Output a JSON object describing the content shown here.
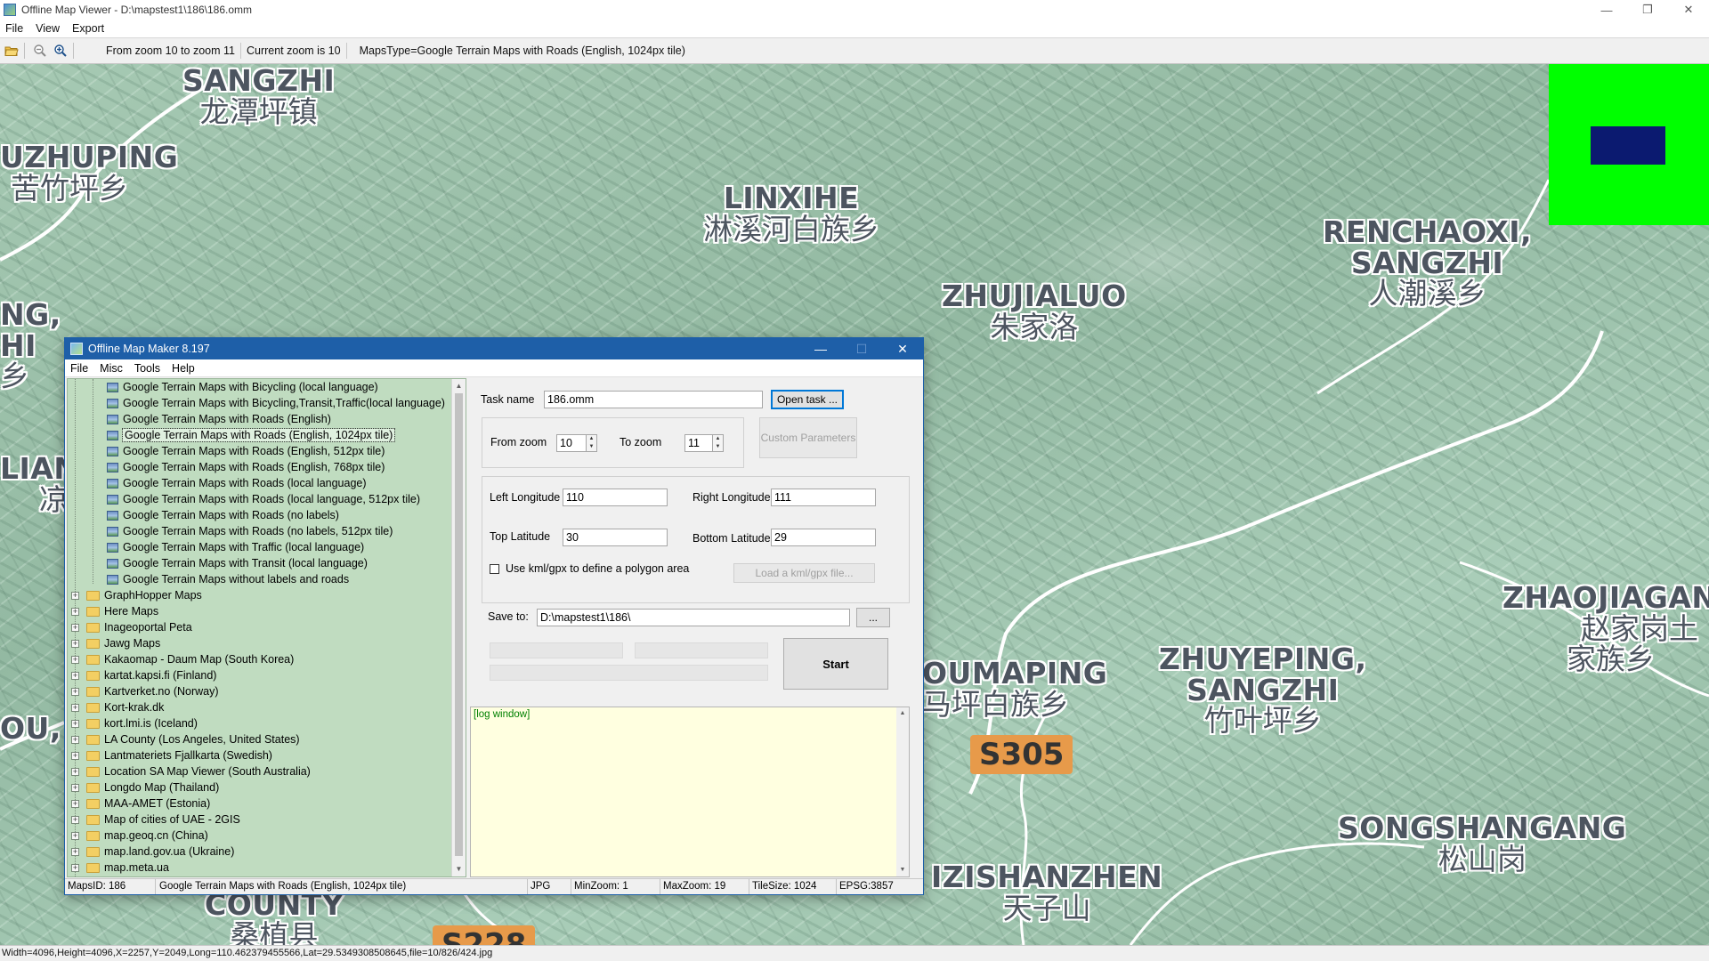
{
  "window": {
    "title": "Offline Map Viewer - D:\\mapstest1\\186\\186.omm",
    "controls": {
      "minimize": "—",
      "restore": "❐",
      "close": "✕"
    }
  },
  "menu": [
    "File",
    "View",
    "Export"
  ],
  "toolbar": {
    "zoom_range": "From zoom 10 to zoom 11",
    "current_zoom": "Current zoom is 10",
    "maps_type": "MapsType=Google Terrain Maps with Roads (English, 1024px tile)"
  },
  "map": {
    "places": [
      {
        "latin": "SANGZHI",
        "cn": "龙潭坪镇"
      },
      {
        "latin": "UZHUPING",
        "cn": "苦竹坪乡"
      },
      {
        "latin": "LINXIHE",
        "cn": "淋溪河白族乡"
      },
      {
        "latin": "RENCHAOXI,",
        "latin2": "SANGZHI",
        "cn": "人潮溪乡"
      },
      {
        "latin": "ZHUJIALUO",
        "cn": "朱家洛"
      },
      {
        "latin": "ZHAOJIAGAN",
        "cn": "赵家岗土",
        "cn2": "家族乡"
      },
      {
        "latin": "ZHUYEPING,",
        "latin2": "SANGZHI",
        "cn": "竹叶坪乡"
      },
      {
        "latin": "OUMAPING",
        "cn": "马坪白族乡"
      },
      {
        "latin": "SONGSHANGANG",
        "cn": "松山岗"
      },
      {
        "latin": "IZISHANZHEN",
        "cn": "天子山"
      },
      {
        "latin": "COUNTY",
        "cn": "桑植县"
      },
      {
        "latin": "NG,",
        "latin2": "HI",
        "cn": "乡"
      },
      {
        "latin": "LIANG",
        "cn": "凉"
      },
      {
        "latin": "OU,",
        "cn": ""
      }
    ],
    "road_shields": [
      "S305",
      "S228"
    ],
    "accent_colors": {
      "minimap_bg": "#00ff00",
      "minimap_viewport": "#0b1a70"
    }
  },
  "status_bar": "Width=4096,Height=4096,X=2257,Y=2049,Long=110.462379455566,Lat=29.5349308508645,file=10/826/424.jpg",
  "dialog": {
    "title": "Offline Map Maker 8.197",
    "menu": [
      "File",
      "Misc",
      "Tools",
      "Help"
    ],
    "tree_maps": [
      "Google Terrain Maps with Bicycling (local language)",
      "Google Terrain Maps with Bicycling,Transit,Traffic(local language)",
      "Google Terrain Maps with Roads (English)",
      "Google Terrain Maps with Roads (English, 1024px tile)",
      "Google Terrain Maps with Roads (English, 512px tile)",
      "Google Terrain Maps with Roads (English, 768px tile)",
      "Google Terrain Maps with Roads (local language)",
      "Google Terrain Maps with Roads (local language, 512px tile)",
      "Google Terrain Maps with Roads (no labels)",
      "Google Terrain Maps with Roads (no labels, 512px tile)",
      "Google Terrain Maps with Traffic (local language)",
      "Google Terrain Maps with Transit (local language)",
      "Google Terrain Maps without labels and roads"
    ],
    "tree_folders": [
      "GraphHopper Maps",
      "Here Maps",
      "Inageoportal Peta",
      "Jawg Maps",
      "Kakaomap - Daum Map (South Korea)",
      "kartat.kapsi.fi (Finland)",
      "Kartverket.no (Norway)",
      "Kort-krak.dk",
      "kort.lmi.is (Iceland)",
      "LA County (Los Angeles, United States)",
      "Lantmateriets Fjallkarta (Swedish)",
      "Location SA Map Viewer (South Australia)",
      "Longdo Map (Thailand)",
      "MAA-AMET (Estonia)",
      "Map of cities of UAE - 2GIS",
      "map.geoq.cn (China)",
      "map.land.gov.ua (Ukraine)",
      "map.meta.ua"
    ],
    "selected_index": 3,
    "form": {
      "task_name_label": "Task name",
      "task_name_value": "186.omm",
      "open_task_button": "Open task ...",
      "from_zoom_label": "From zoom",
      "from_zoom_value": "10",
      "to_zoom_label": "To zoom",
      "to_zoom_value": "11",
      "custom_params_button": "Custom Parameters",
      "left_lon_label": "Left Longitude",
      "left_lon_value": "110",
      "right_lon_label": "Right Longitude",
      "right_lon_value": "111",
      "top_lat_label": "Top Latitude",
      "top_lat_value": "30",
      "bottom_lat_label": "Bottom Latitude",
      "bottom_lat_value": "29",
      "kml_checkbox_label": "Use kml/gpx to define a polygon area",
      "kml_load_button": "Load a kml/gpx file...",
      "save_to_label": "Save to:",
      "save_to_value": "D:\\mapstest1\\186\\",
      "browse_button": "...",
      "start_button": "Start",
      "log_text": "[log window]"
    },
    "status": {
      "maps_id": "MapsID: 186",
      "map_name": "Google Terrain Maps with Roads (English, 1024px tile)",
      "format": "JPG",
      "min_zoom": "MinZoom: 1",
      "max_zoom": "MaxZoom: 19",
      "tile_size": "TileSize: 1024",
      "epsg": "EPSG:3857"
    }
  }
}
